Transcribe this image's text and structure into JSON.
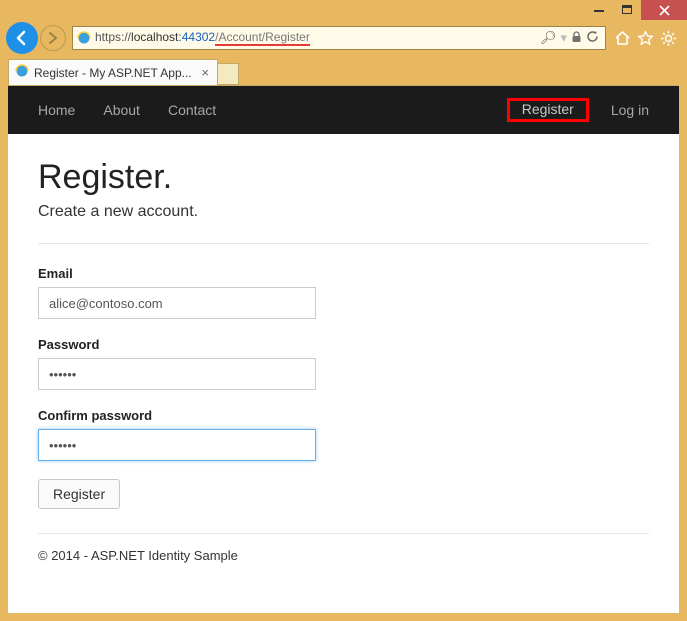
{
  "window": {
    "tab_title": "Register - My ASP.NET App...",
    "url_proto": "https://",
    "url_host": "localhost",
    "url_port": ":44302",
    "url_path_highlight": "/Account/Register",
    "search_glyph": "⌕"
  },
  "navbar": {
    "home": "Home",
    "about": "About",
    "contact": "Contact",
    "register": "Register",
    "login": "Log in"
  },
  "page": {
    "title": "Register.",
    "subtitle": "Create a new account.",
    "email_label": "Email",
    "email_value": "alice@contoso.com",
    "password_label": "Password",
    "password_value": "••••••",
    "confirm_label": "Confirm password",
    "confirm_value": "••••••",
    "submit_label": "Register",
    "footer": "© 2014 - ASP.NET Identity Sample"
  }
}
